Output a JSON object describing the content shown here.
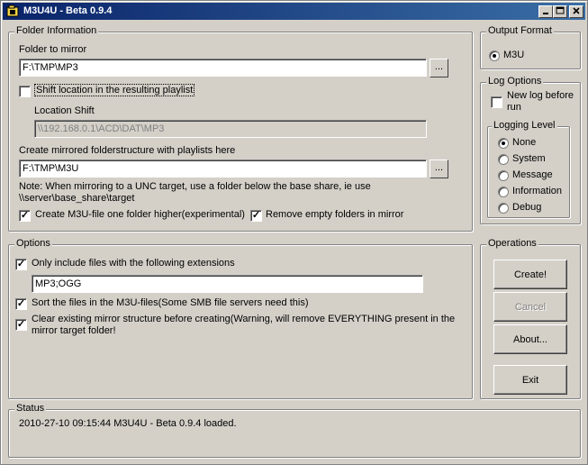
{
  "window": {
    "title": "M3U4U - Beta 0.9.4"
  },
  "folder_info": {
    "legend": "Folder Information",
    "mirror_label": "Folder to mirror",
    "mirror_value": "F:\\TMP\\MP3",
    "browse_label": "...",
    "shift_label": "Shift location in the resulting playlist",
    "shift_checked": false,
    "location_shift_label": "Location Shift",
    "location_shift_value": "\\\\192.168.0.1\\ACD\\DAT\\MP3",
    "create_label": "Create mirrored folderstructure with playlists here",
    "create_value": "F:\\TMP\\M3U",
    "note_line1": "Note: When mirroring to a UNC target, use a folder below the base share, ie use",
    "note_line2": "\\\\server\\base_share\\target",
    "higher_label": "Create M3U-file one folder higher(experimental)",
    "higher_checked": true,
    "remove_empty_label": "Remove empty folders in mirror",
    "remove_empty_checked": true
  },
  "output_format": {
    "legend": "Output Format",
    "option": "M3U",
    "selected": true
  },
  "log_options": {
    "legend": "Log Options",
    "new_log_label_line1": "New log before",
    "new_log_label_line2": "run",
    "new_log_checked": false,
    "level_legend": "Logging Level",
    "levels": [
      "None",
      "System",
      "Message",
      "Information",
      "Debug"
    ],
    "selected_level": "None"
  },
  "options": {
    "legend": "Options",
    "include_label": "Only include files with the following extensions",
    "include_checked": true,
    "extensions_value": "MP3;OGG",
    "sort_label": "Sort the files in the M3U-files(Some SMB file servers need this)",
    "sort_checked": true,
    "clear_label_line1": "Clear existing mirror structure before creating(Warning, will remove EVERYTHING present in the",
    "clear_label_line2": "mirror target folder!",
    "clear_checked": true
  },
  "operations": {
    "legend": "Operations",
    "create": "Create!",
    "cancel": "Cancel",
    "about": "About...",
    "exit": "Exit"
  },
  "status": {
    "legend": "Status",
    "message": "2010-27-10 09:15:44 M3U4U - Beta 0.9.4 loaded."
  }
}
